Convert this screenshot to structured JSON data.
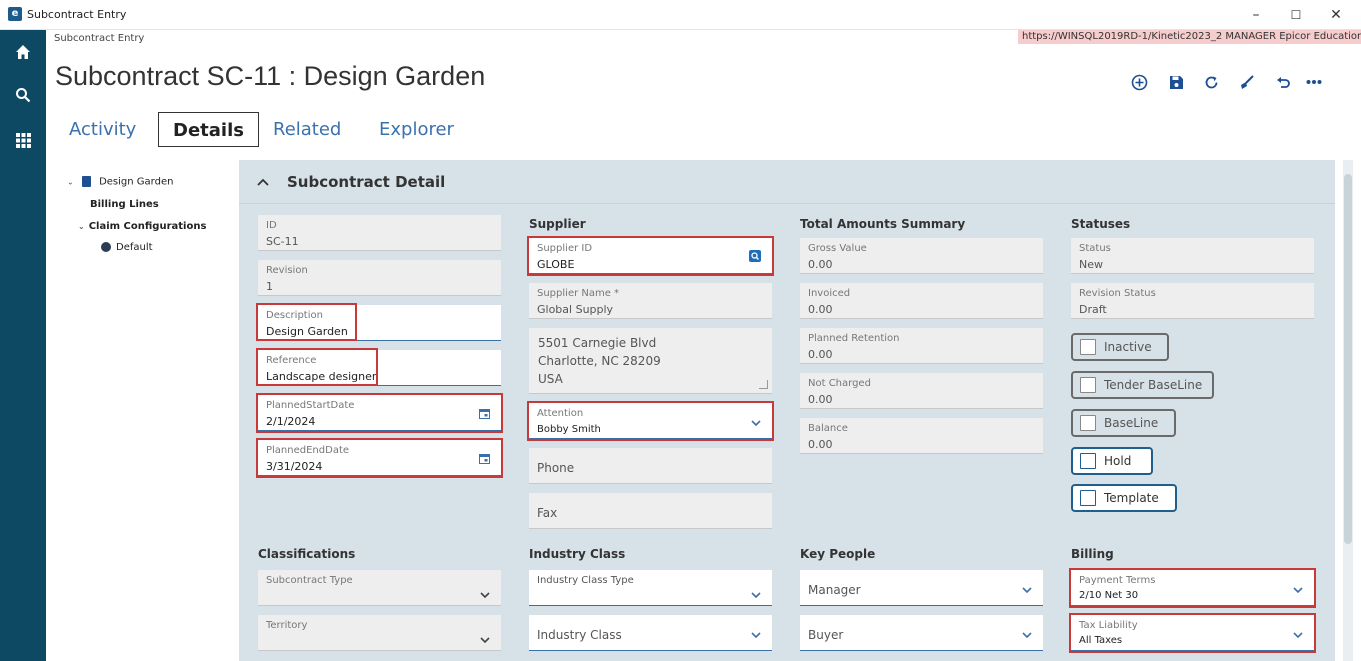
{
  "window": {
    "title": "Subcontract Entry",
    "minimize": "–",
    "maximize": "☐",
    "close": "✕"
  },
  "breadcrumb": "Subcontract Entry",
  "env_info": "https://WINSQL2019RD-1/Kinetic2023_2   MANAGER   Epicor Education",
  "page_title": "Subcontract SC-11 : Design Garden",
  "toolbar": [
    "add-icon",
    "save-icon",
    "refresh-icon",
    "clear-icon",
    "undo-icon",
    "more-icon"
  ],
  "tabs": [
    "Activity",
    "Details",
    "Related",
    "Explorer"
  ],
  "active_tab": "Details",
  "tree": {
    "root": "Design Garden",
    "billing": "Billing Lines",
    "claims": "Claim Configurations",
    "default": "Default"
  },
  "section_title": "Subcontract Detail",
  "col1": {
    "id_label": "ID",
    "id_value": "SC-11",
    "revision_label": "Revision",
    "revision_value": "1",
    "description_label": "Description",
    "description_value": "Design Garden",
    "reference_label": "Reference",
    "reference_value": "Landscape designer",
    "start_label": "PlannedStartDate",
    "start_value": "2/1/2024",
    "end_label": "PlannedEndDate",
    "end_value": "3/31/2024"
  },
  "supplier": {
    "heading": "Supplier",
    "id_label": "Supplier ID",
    "id_value": "GLOBE",
    "name_label": "Supplier Name *",
    "name_value": "Global Supply",
    "address": [
      "5501 Carnegie Blvd",
      "Charlotte, NC  28209",
      "USA"
    ],
    "attention_label": "Attention",
    "attention_value": "Bobby Smith",
    "phone_placeholder": "Phone",
    "fax_placeholder": "Fax"
  },
  "totals": {
    "heading": "Total Amounts Summary",
    "items": [
      {
        "label": "Gross Value",
        "value": "0.00"
      },
      {
        "label": "Invoiced",
        "value": "0.00"
      },
      {
        "label": "Planned Retention",
        "value": "0.00"
      },
      {
        "label": "Not Charged",
        "value": "0.00"
      },
      {
        "label": "Balance",
        "value": "0.00"
      }
    ]
  },
  "statuses": {
    "heading": "Statuses",
    "status_label": "Status",
    "status_value": "New",
    "revision_status_label": "Revision Status",
    "revision_status_value": "Draft",
    "checkboxes": [
      "Inactive",
      "Tender BaseLine",
      "BaseLine",
      "Hold",
      "Template"
    ]
  },
  "classifications": {
    "heading": "Classifications",
    "subcontract_type": "Subcontract Type",
    "territory": "Territory"
  },
  "industry": {
    "heading": "Industry Class",
    "type_label": "Industry Class Type",
    "class_placeholder": "Industry Class"
  },
  "key_people": {
    "heading": "Key People",
    "manager": "Manager",
    "buyer": "Buyer"
  },
  "billing": {
    "heading": "Billing",
    "payment_label": "Payment Terms",
    "payment_value": "2/10 Net 30",
    "tax_label": "Tax Liability",
    "tax_value": "All Taxes"
  }
}
